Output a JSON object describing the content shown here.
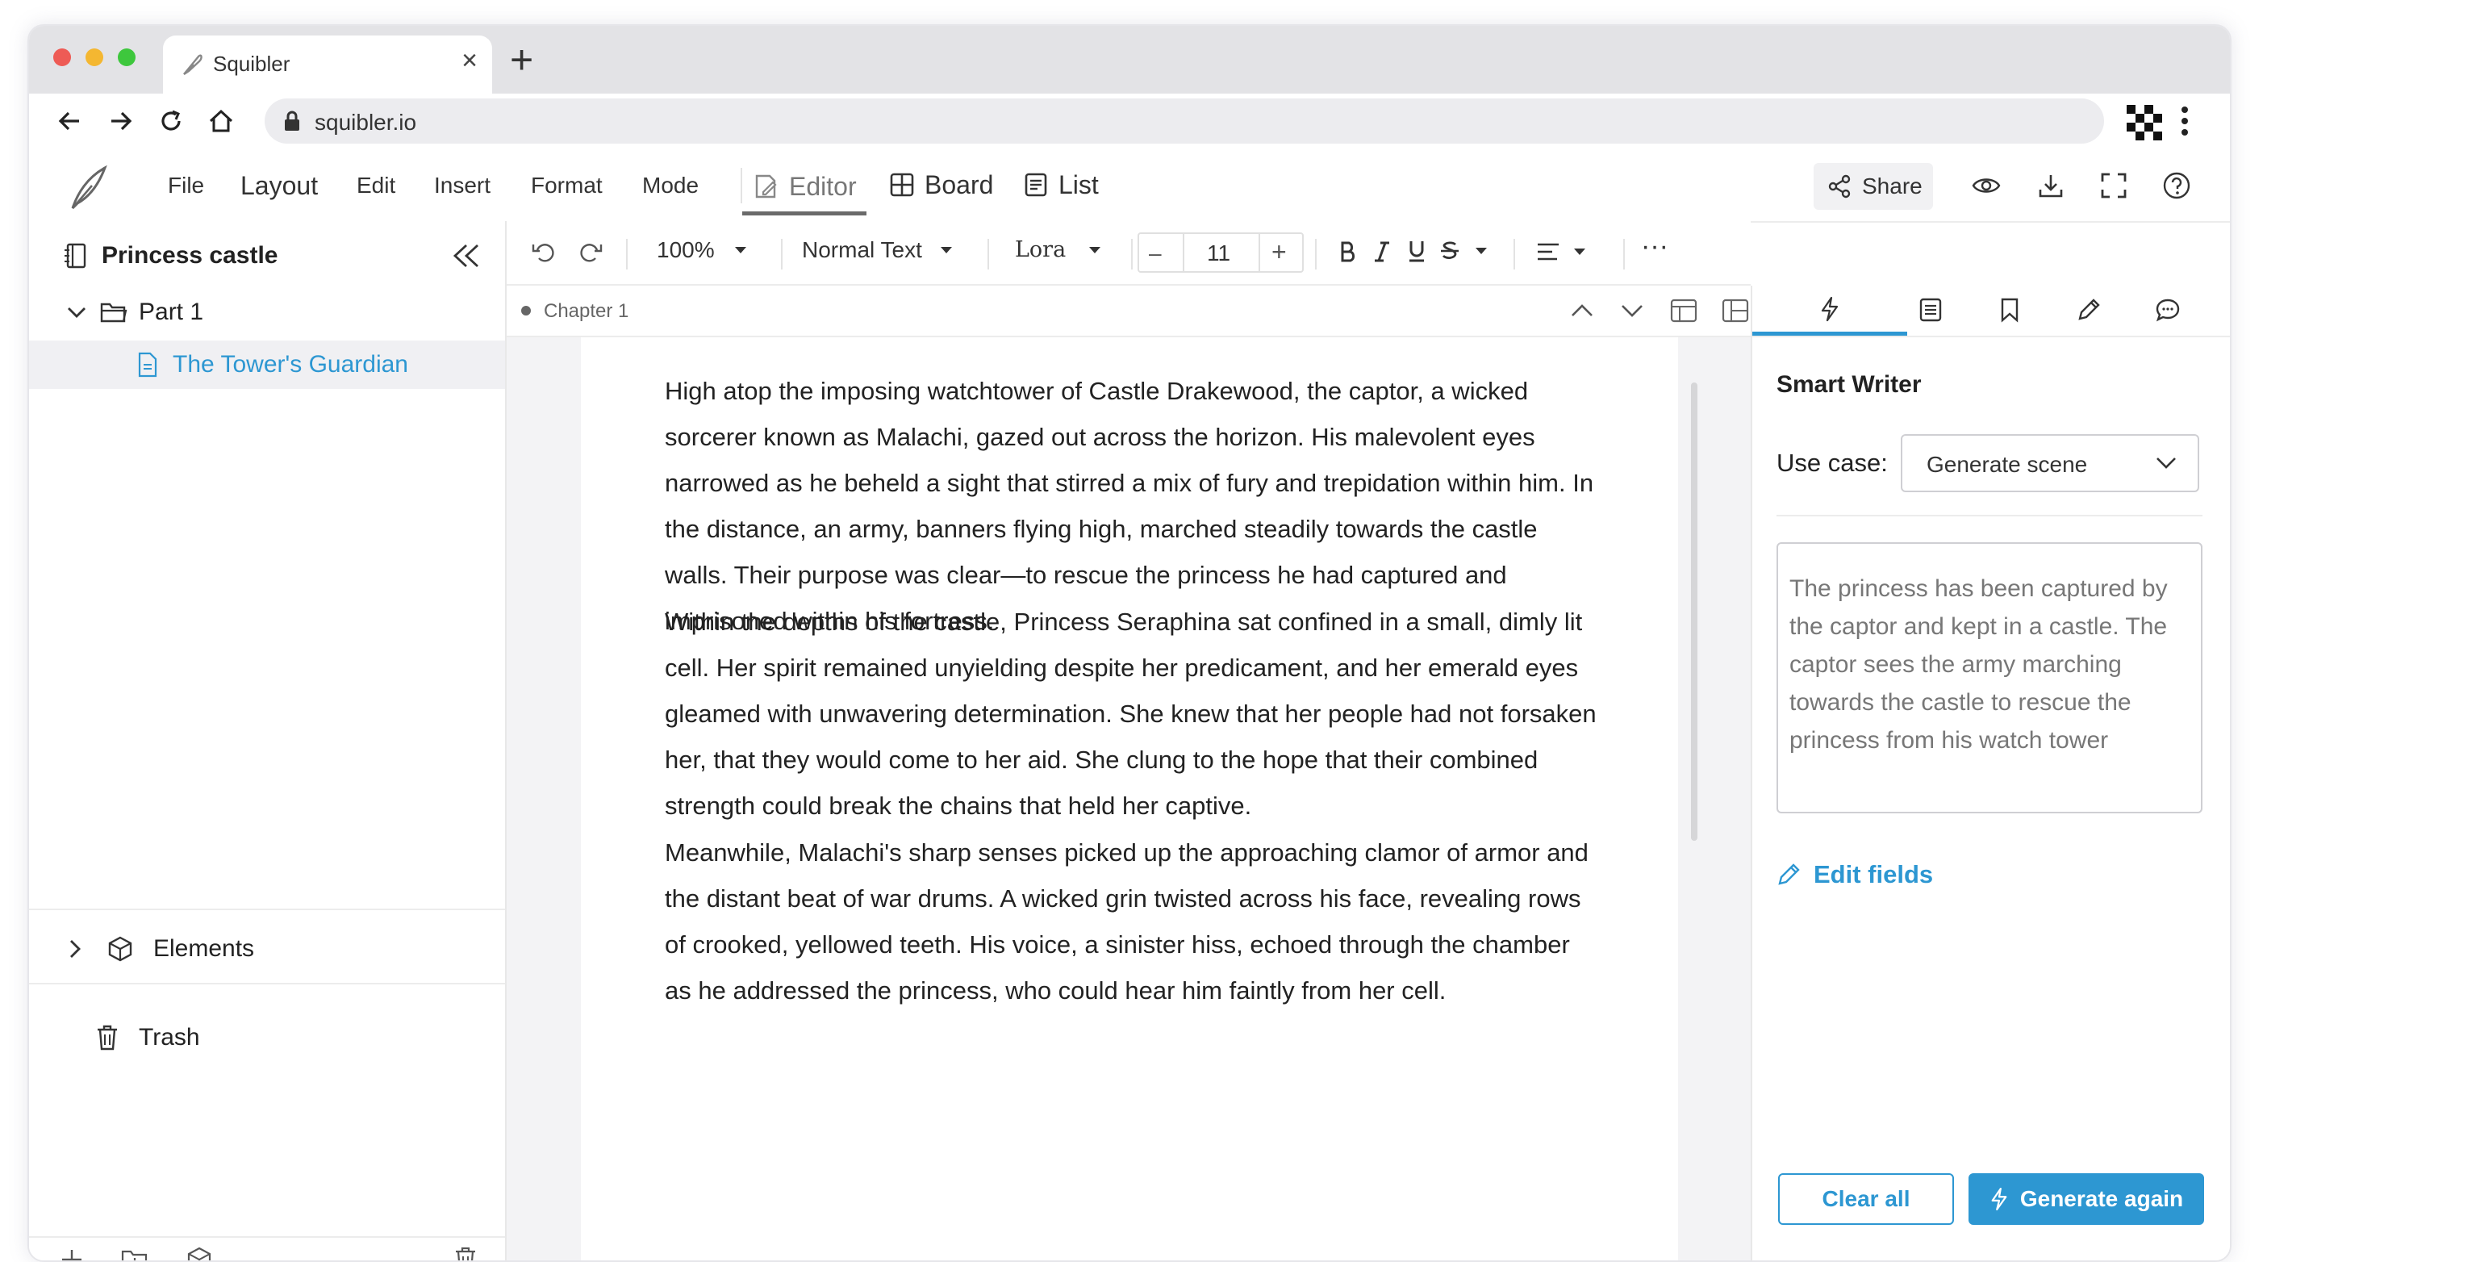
{
  "browser": {
    "tab_title": "Squibler",
    "tab_close": "×",
    "new_tab": "+",
    "url": "squibler.io"
  },
  "menu": {
    "items": [
      "File",
      "Layout",
      "Edit",
      "Insert",
      "Format",
      "Mode"
    ],
    "views": [
      "Editor",
      "Board",
      "List"
    ],
    "share_label": "Share"
  },
  "sidebar": {
    "project_title": "Princess castle",
    "part_label": "Part 1",
    "document_label": "The Tower's Guardian",
    "elements_label": "Elements",
    "trash_label": "Trash"
  },
  "toolbar": {
    "zoom": "100%",
    "style": "Normal Text",
    "font": "Lora",
    "font_size": "11",
    "decrease": "–",
    "increase": "+",
    "more": "···"
  },
  "editor": {
    "chapter": "Chapter 1",
    "paragraphs": [
      "High atop the imposing watchtower of Castle Drakewood, the captor, a wicked sorcerer known as Malachi, gazed out across the horizon. His malevolent eyes narrowed as he beheld a sight that stirred a mix of fury and trepidation within him. In the distance, an army, banners flying high, marched steadily towards the castle walls. Their purpose was clear—to rescue the princess he had captured and imprisoned within his fortress.",
      "Within the depths of the castle, Princess Seraphina sat confined in a small, dimly lit cell. Her spirit remained unyielding despite her predicament, and her emerald eyes gleamed with unwavering determination. She knew that her people had not forsaken her, that they would come to her aid. She clung to the hope that their combined strength could break the chains that held her captive.",
      "Meanwhile, Malachi's sharp senses picked up the approaching clamor of armor and the distant beat of war drums. A wicked grin twisted across his face, revealing rows of crooked, yellowed teeth. His voice, a sinister hiss, echoed through the chamber as he addressed the princess, who could hear him faintly from her cell."
    ]
  },
  "smart_writer": {
    "title": "Smart Writer",
    "use_case_label": "Use case:",
    "use_case_value": "Generate scene",
    "prompt": "The princess has been captured by the captor and kept in a castle. The captor sees the army marching towards the castle to rescue the princess from his watch tower",
    "edit_fields": "Edit fields",
    "clear_all": "Clear all",
    "generate_again": "Generate again"
  },
  "colors": {
    "accent": "#2d97d2",
    "dot_red": "#ee5b55",
    "dot_yellow": "#f4b731",
    "dot_green": "#3ec73d"
  }
}
